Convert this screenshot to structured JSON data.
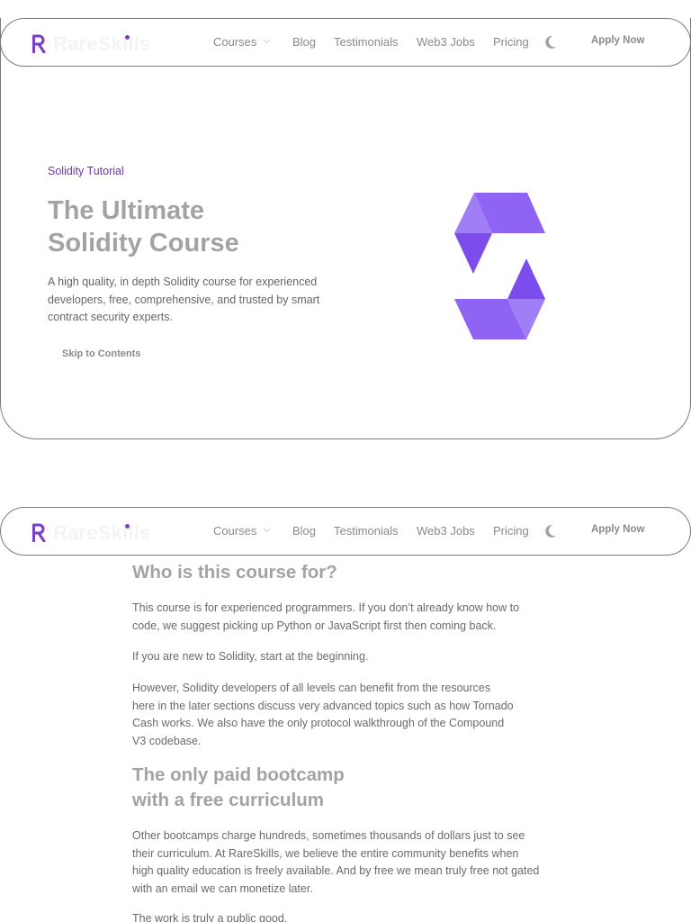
{
  "nav": {
    "logo_text": "RareSkills",
    "links": [
      "Courses",
      "Blog",
      "Testimonials",
      "Web3 Jobs",
      "Pricing"
    ],
    "apply_label": "Apply Now",
    "brand_color": "#7a3ec7"
  },
  "hero": {
    "eyebrow": "Solidity Tutorial",
    "title_lines": [
      "The Ultimate",
      "Solidity Course"
    ],
    "description_lines": [
      "A high quality, in depth Solidity course for experienced",
      "developers, free, comprehensive, and trusted by smart",
      "contract security experts."
    ],
    "skip_label": "Skip to Contents",
    "logo_icon": "solidity-logo-icon"
  },
  "content": {
    "section1": {
      "heading": "Who is this course for?",
      "p1_lines": [
        "This course is for experienced programmers. If you don’t already know how to",
        "code, we suggest picking up Python or JavaScript first then coming back."
      ],
      "p2_lines": [
        "If you are new to Solidity, start at the beginning."
      ],
      "p3_lines": [
        "However, Solidity developers of all levels can benefit from the resources",
        "here in the later sections discuss very advanced topics such as how Tornado",
        "Cash works. We also have the only protocol walkthrough of the Compound",
        "V3 codebase."
      ]
    },
    "section2": {
      "heading_lines": [
        "The only paid bootcamp",
        "with a free curriculum"
      ],
      "p1_lines": [
        "Other bootcamps charge hundreds, sometimes thousands of dollars just to see",
        "their curriculum. At RareSkills, we believe the entire community benefits when",
        "high quality education is freely available. And by free we mean truly free not gated",
        "with an email we can monetize later."
      ],
      "p2_lines": [
        "The work is truly a public good."
      ]
    }
  }
}
